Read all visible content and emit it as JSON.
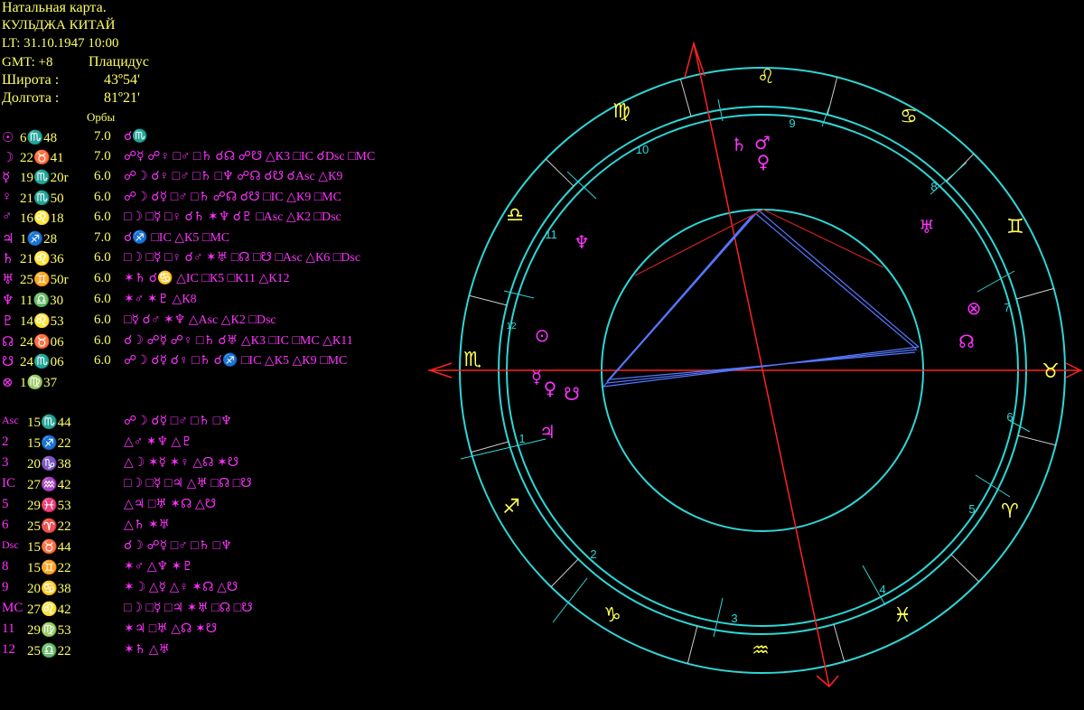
{
  "header": {
    "title": "Натальная карта.",
    "place": "КУЛЬДЖА КИТАЙ",
    "local_time": "LT: 31.10.1947  10:00",
    "gmt": "GMT: +8",
    "house_system": "Плацидус",
    "latitude_label": "Широта :",
    "latitude_value": "43º54'",
    "longitude_label": "Долгота :",
    "longitude_value": "81º21'",
    "orbs_label": "Орбы"
  },
  "planets": [
    {
      "glyph": "☉",
      "pos": "6♏48",
      "orb": "7.0",
      "aspects": "☌♏"
    },
    {
      "glyph": "☽",
      "pos": "22♉41",
      "orb": "7.0",
      "aspects": "☍☿ ☍♀ □♂ □♄ ☌☊ ☍☋   △К3 □IC ☌Dsc □MC"
    },
    {
      "glyph": "☿",
      "pos": "19♏20r",
      "orb": "6.0",
      "aspects": "☍☽ ☌♀ □♂ □♄ □♆ ☍☊ ☌☋   ☌Asc △К9"
    },
    {
      "glyph": "♀",
      "pos": "21♏50",
      "orb": "6.0",
      "aspects": "☍☽ ☌☿ □♂ □♄ ☍☊ ☌☋   □IC △К9 □MC"
    },
    {
      "glyph": "♂",
      "pos": "16♌18",
      "orb": "6.0",
      "aspects": "□☽ □☿ □♀ ☌♄ ✶♆ ☌♇   □Asc △К2 □Dsc"
    },
    {
      "glyph": "♃",
      "pos": "1♐28",
      "orb": "7.0",
      "aspects": "☌♐ □IC △К5 □MC"
    },
    {
      "glyph": "♄",
      "pos": "21♌36",
      "orb": "6.0",
      "aspects": "□☽ □☿ □♀ ☌♂ ✶♅ □☊ □☋   □Asc △К6 □Dsc"
    },
    {
      "glyph": "♅",
      "pos": "25♊50r",
      "orb": "6.0",
      "aspects": "✶♄ ☌♋ △IC □К5 □К11 △К12"
    },
    {
      "glyph": "♆",
      "pos": "11♎30",
      "orb": "6.0",
      "aspects": "✶♂ ✶♇ △К8"
    },
    {
      "glyph": "♇",
      "pos": "14♌53",
      "orb": "6.0",
      "aspects": "□☿ ☌♂ ✶♆ △Asc △К2 □Dsc"
    },
    {
      "glyph": "☊",
      "pos": "24♉06",
      "orb": "6.0",
      "aspects": "☌☽ ☍☿ ☍♀ □♄ ☌♅   △К3 □IC □MC   △К11"
    },
    {
      "glyph": "☋",
      "pos": "24♏06",
      "orb": "6.0",
      "aspects": "☍☽ ☌☿ ☌♀ □♄ ☌♐ □IC △К5 △К9 □MC"
    },
    {
      "glyph": "⊗",
      "pos": "1♍37",
      "orb": "",
      "aspects": ""
    }
  ],
  "houses": [
    {
      "label": "Asc",
      "pos": "15♏44",
      "aspects": "☍☽ ☌☿ □♂ □♄ □♆"
    },
    {
      "label": "2",
      "pos": "15♐22",
      "aspects": "△♂ ✶♆ △♇"
    },
    {
      "label": "3",
      "pos": "20♑38",
      "aspects": "△☽ ✶☿ ✶♀ △☊ ✶☋"
    },
    {
      "label": "IC",
      "pos": "27♒42",
      "aspects": "□☽ □☿ □♃ △♅ □☊ □☋"
    },
    {
      "label": "5",
      "pos": "29♓53",
      "aspects": "△♃ □♅ ✶☊ △☋"
    },
    {
      "label": "6",
      "pos": "25♈22",
      "aspects": "△♄ ✶♅"
    },
    {
      "label": "Dsc",
      "pos": "15♉44",
      "aspects": "☌☽ ☍☿ □♂ □♄ □♆"
    },
    {
      "label": "8",
      "pos": "15♊22",
      "aspects": "✶♂ △♆ ✶♇"
    },
    {
      "label": "9",
      "pos": "20♋38",
      "aspects": "✶☽ △☿ △♀ ✶☊ △☋"
    },
    {
      "label": "MC",
      "pos": "27♌42",
      "aspects": "□☽ □☿ □♃ ✶♅ □☊ □☋"
    },
    {
      "label": "11",
      "pos": "29♍53",
      "aspects": "✶♃ □♅ △☊ ✶☋"
    },
    {
      "label": "12",
      "pos": "25♎22",
      "aspects": "✶♄ △♅"
    }
  ],
  "wheel": {
    "zodiac_signs": [
      "♈",
      "♉",
      "♊",
      "♋",
      "♌",
      "♍",
      "♎",
      "♏",
      "♐",
      "♑",
      "♒",
      "♓"
    ],
    "house_numbers": [
      "1",
      "2",
      "3",
      "4",
      "5",
      "6",
      "7",
      "8",
      "9",
      "10",
      "11",
      "12"
    ],
    "planet_glyphs": [
      "♄",
      "♂",
      "♀",
      "♆",
      "⊙",
      "☿",
      "♀",
      "☋",
      "♃",
      "⊗",
      "☊",
      "♅"
    ],
    "colors": {
      "ring": "#2fd6d6",
      "sign": "#ffff55",
      "planet": "#ff33ff",
      "axis": "#ff2222",
      "aspect_blue": "#5577ff",
      "aspect_red": "#cc2222"
    }
  }
}
